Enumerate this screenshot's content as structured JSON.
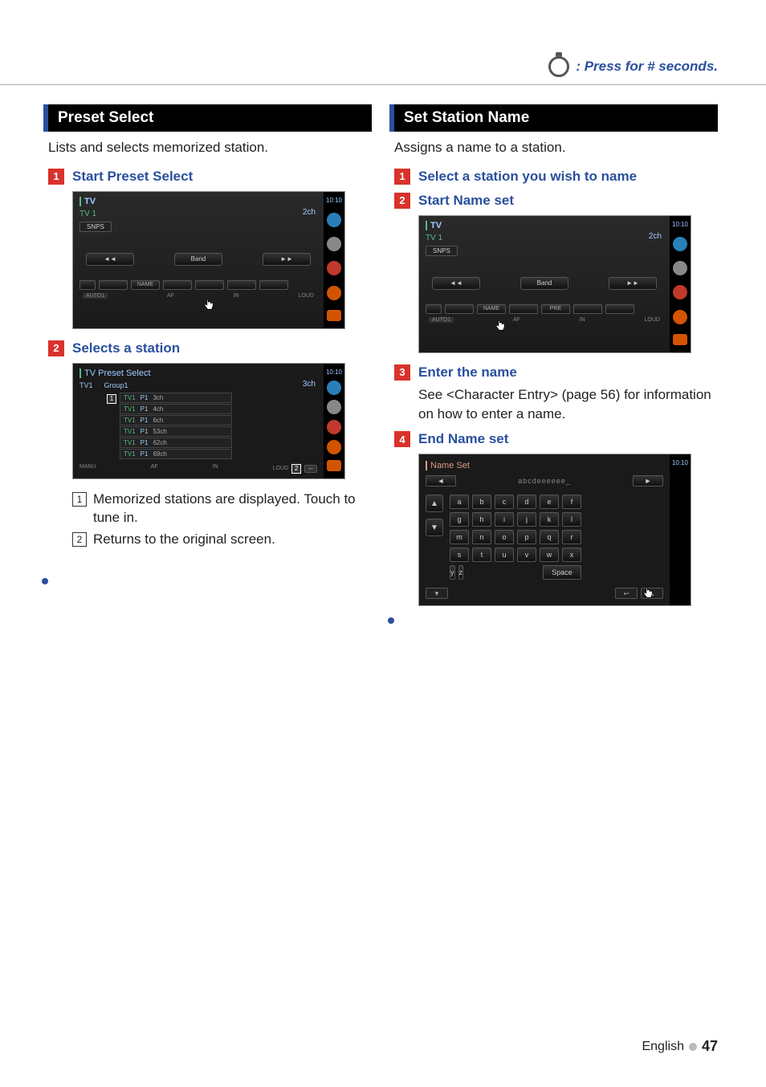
{
  "header": {
    "hint_text": ": Press for # seconds."
  },
  "left": {
    "section_title": "Preset Select",
    "section_desc": "Lists and selects memorized station.",
    "step1": {
      "num": "1",
      "label": "Start Preset Select"
    },
    "screenshot1": {
      "title": "TV",
      "sub": "TV 1",
      "channel": "2ch",
      "pill": "SNPS",
      "time": "10:10",
      "btn_prev": "◄◄",
      "btn_band": "Band",
      "btn_next": "►►",
      "mini_name": "NAME",
      "footer_mode": "AUTO1",
      "footer_af": "AF",
      "footer_in": "IN",
      "footer_loud": "LOUD"
    },
    "step2": {
      "num": "2",
      "label": "Selects a station"
    },
    "screenshot2": {
      "title": "TV Preset Select",
      "sub1": "TV1",
      "sub2": "Group1",
      "channel": "3ch",
      "time": "10:10",
      "rows": [
        {
          "a": "TV1",
          "b": "P1",
          "c": "3ch"
        },
        {
          "a": "TV1",
          "b": "P1",
          "c": "4ch"
        },
        {
          "a": "TV1",
          "b": "P1",
          "c": "6ch"
        },
        {
          "a": "TV1",
          "b": "P1",
          "c": "53ch"
        },
        {
          "a": "TV1",
          "b": "P1",
          "c": "62ch"
        },
        {
          "a": "TV1",
          "b": "P1",
          "c": "69ch"
        }
      ],
      "callout1": "1",
      "callout2": "2",
      "footer_mode": "MANU",
      "footer_af": "AF",
      "footer_in": "IN",
      "footer_loud": "LOUD",
      "return_icon": "↩"
    },
    "notes": {
      "n1_num": "1",
      "n1_text": "Memorized stations are displayed. Touch to tune in.",
      "n2_num": "2",
      "n2_text": "Returns to the original screen."
    }
  },
  "right": {
    "section_title": "Set Station Name",
    "section_desc": "Assigns a name to a station.",
    "step1": {
      "num": "1",
      "label": "Select a station you wish to name"
    },
    "step2": {
      "num": "2",
      "label": "Start Name set"
    },
    "screenshot2": {
      "title": "TV",
      "sub": "TV 1",
      "channel": "2ch",
      "pill": "SNPS",
      "time": "10:10",
      "btn_prev": "◄◄",
      "btn_band": "Band",
      "btn_next": "►►",
      "mini_name": "NAME",
      "mini_pre": "PRE",
      "footer_mode": "AUTO1",
      "footer_af": "AF",
      "footer_in": "IN",
      "footer_loud": "LOUD"
    },
    "step3": {
      "num": "3",
      "label": "Enter the name"
    },
    "step3_text": "See <Character Entry> (page 56) for information on how to enter a name.",
    "step4": {
      "num": "4",
      "label": "End Name set"
    },
    "nameset": {
      "title": "Name Set",
      "time": "10:10",
      "arrow_left": "◄",
      "entry_text": "abcdeeeeee_",
      "arrow_right": "►",
      "up": "▲",
      "down": "▼",
      "keys_r1": [
        "a",
        "b",
        "c",
        "d",
        "e",
        "f"
      ],
      "keys_r2": [
        "g",
        "h",
        "i",
        "j",
        "k",
        "l"
      ],
      "keys_r3": [
        "m",
        "n",
        "o",
        "p",
        "q",
        "r"
      ],
      "keys_r4": [
        "s",
        "t",
        "u",
        "v",
        "w",
        "x"
      ],
      "keys_r5": [
        "y",
        "z"
      ],
      "space": "Space",
      "bottom_left": "▼",
      "bottom_right_return": "↩",
      "bottom_right_up": "▲"
    }
  },
  "footer": {
    "lang": "English",
    "page": "47"
  }
}
